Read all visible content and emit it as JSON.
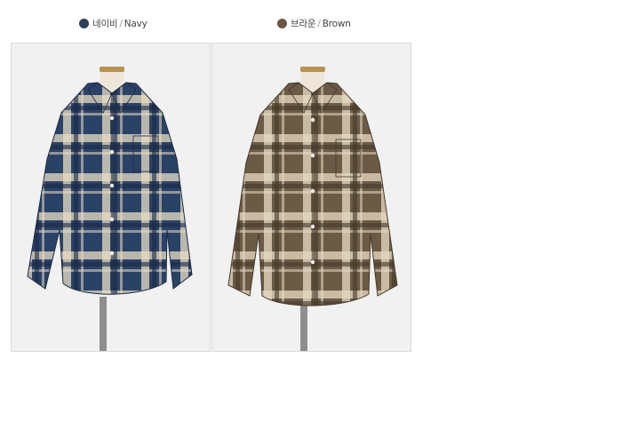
{
  "products": [
    {
      "name_ko": "네이비",
      "separator": "/",
      "name_en": "Navy",
      "swatch_color": "#2e4058",
      "shirt_base": "#2b4267",
      "shirt_light": "#e8dcc2",
      "shirt_dark": "#1b2a44"
    },
    {
      "name_ko": "브라운",
      "separator": "/",
      "name_en": "Brown",
      "swatch_color": "#6b5545",
      "shirt_base": "#6b5a45",
      "shirt_light": "#e6d9c3",
      "shirt_dark": "#45382a"
    }
  ]
}
